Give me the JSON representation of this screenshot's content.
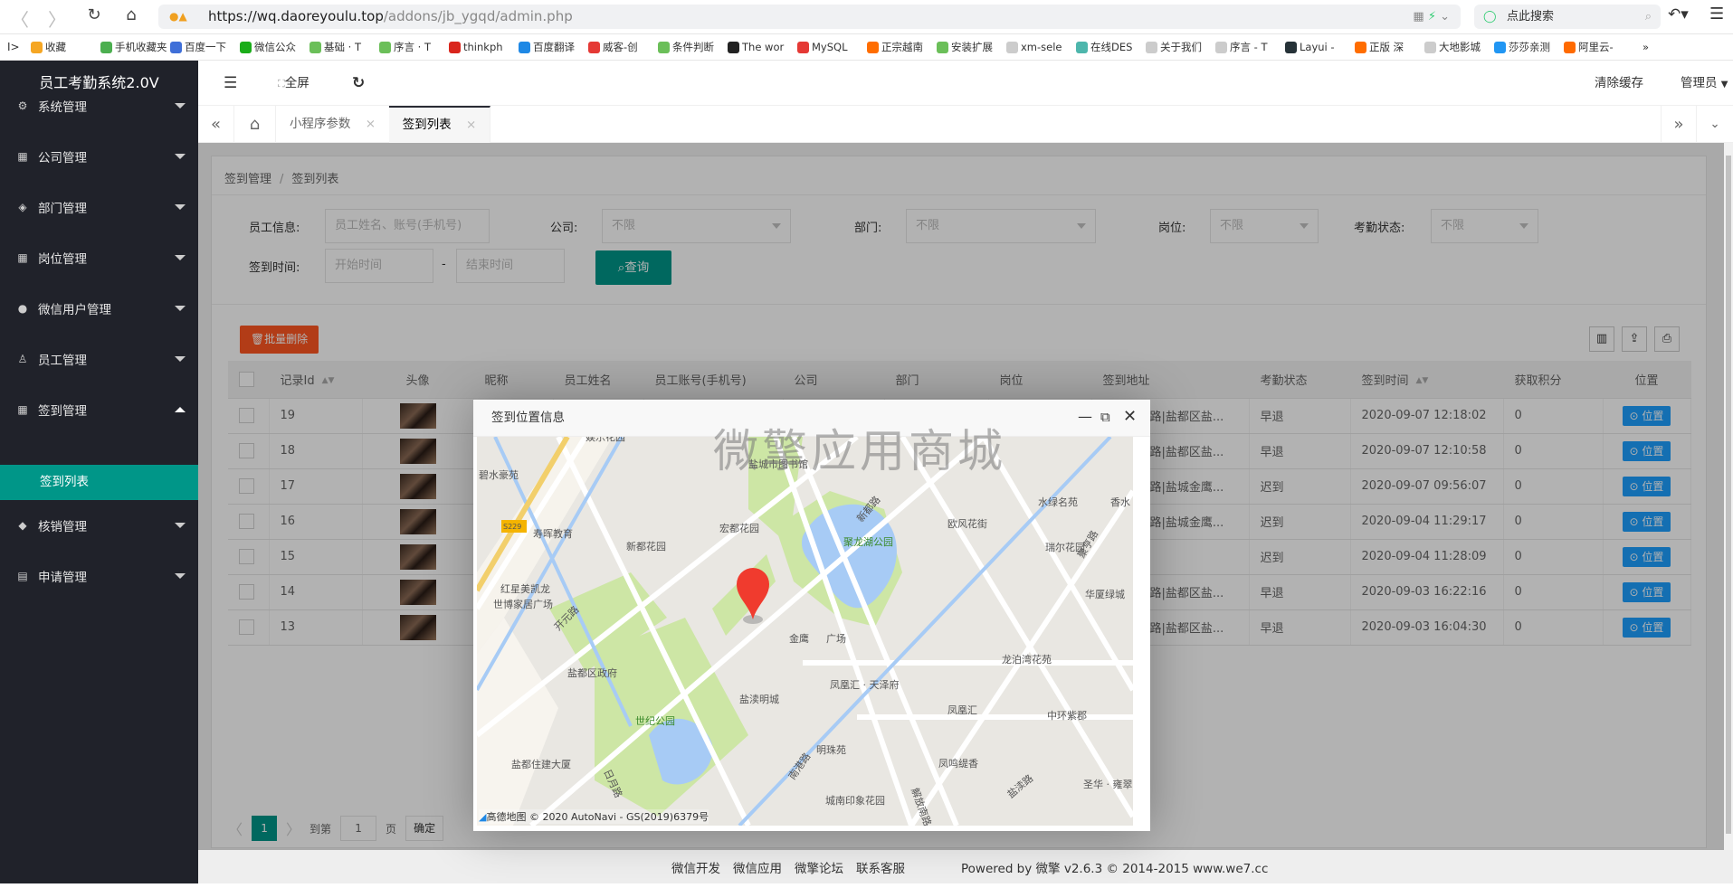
{
  "browser": {
    "url_host": "https://wq.daoreyoulu.top",
    "url_path": "/addons/jb_ygqd/admin.php",
    "search_placeholder": "点此搜索",
    "bookmarks": [
      "收藏",
      "手机收藏夹",
      "百度一下",
      "微信公众",
      "基础 · T",
      "序言 · T",
      "thinkph",
      "百度翻译",
      "威客-创",
      "条件判断",
      "The wor",
      "MySQL",
      "正宗越南",
      "安装扩展",
      "xm-sele",
      "在线DES",
      "关于我们",
      "序言 - T",
      "Layui -",
      "正版 深",
      "大地影城",
      "莎莎亲测",
      "阿里云-"
    ],
    "bookmark_colors": [
      "#f5a623",
      "#4caf50",
      "#3f6fd8",
      "#1aad19",
      "#6bbf59",
      "#6bbf59",
      "#d9251c",
      "#1e88e5",
      "#e53935",
      "#6bbf59",
      "#222222",
      "#e53935",
      "#ff6d00",
      "#6bbf59",
      "#cccccc",
      "#4db6ac",
      "#cccccc",
      "#cccccc",
      "#263238",
      "#ff6d00",
      "#cccccc",
      "#2196f3",
      "#ff6a00"
    ]
  },
  "app": {
    "title": "员工考勤系统2.0V"
  },
  "sidebar": {
    "items": [
      {
        "label": "系统管理",
        "icon": "⚙"
      },
      {
        "label": "公司管理",
        "icon": "▦"
      },
      {
        "label": "部门管理",
        "icon": "◈"
      },
      {
        "label": "岗位管理",
        "icon": "▦"
      },
      {
        "label": "微信用户管理",
        "icon": "●"
      },
      {
        "label": "员工管理",
        "icon": "♙"
      },
      {
        "label": "签到管理",
        "icon": "▦"
      },
      {
        "label": "核销管理",
        "icon": "◆"
      },
      {
        "label": "申请管理",
        "icon": "▤"
      }
    ],
    "active_sub": "签到列表",
    "active_color": "#009688"
  },
  "header": {
    "fullscreen": "全屏",
    "clear_cache": "清除缓存",
    "user": "管理员"
  },
  "tabs": [
    {
      "label": "小程序参数"
    },
    {
      "label": "签到列表",
      "active": true
    }
  ],
  "breadcrumb": [
    "签到管理",
    "签到列表"
  ],
  "filters": {
    "employee_label": "员工信息:",
    "employee_placeholder": "员工姓名、账号(手机号)",
    "company_label": "公司:",
    "company_value": "不限",
    "dept_label": "部门:",
    "dept_value": "不限",
    "post_label": "岗位:",
    "post_value": "不限",
    "status_label": "考勤状态:",
    "status_value": "不限",
    "time_label": "签到时间:",
    "start_placeholder": "开始时间",
    "end_placeholder": "结束时间",
    "dash": "-",
    "search_button": "查询"
  },
  "toolbar": {
    "batch_delete": "批量删除"
  },
  "table": {
    "columns": [
      "记录Id",
      "头像",
      "昵称",
      "员工姓名",
      "员工账号(手机号)",
      "公司",
      "部门",
      "岗位",
      "签到地址",
      "考勤状态",
      "签到时间",
      "获取积分",
      "位置"
    ],
    "rows": [
      {
        "id": "19",
        "address": "路|盐都区盐...",
        "status": "早退",
        "time": "2020-09-07 12:18:02",
        "points": "0",
        "action": "位置"
      },
      {
        "id": "18",
        "address": "路|盐都区盐...",
        "status": "早退",
        "time": "2020-09-07 12:10:58",
        "points": "0",
        "action": "位置"
      },
      {
        "id": "17",
        "address": "路|盐城金鹰...",
        "status": "迟到",
        "time": "2020-09-07 09:56:07",
        "points": "0",
        "action": "位置"
      },
      {
        "id": "16",
        "address": "路|盐城金鹰...",
        "status": "迟到",
        "time": "2020-09-04 11:29:17",
        "points": "0",
        "action": "位置"
      },
      {
        "id": "15",
        "address": "",
        "status": "迟到",
        "time": "2020-09-04 11:28:09",
        "points": "0",
        "action": "位置"
      },
      {
        "id": "14",
        "address": "路|盐都区盐...",
        "status": "早退",
        "time": "2020-09-03 16:22:16",
        "points": "0",
        "action": "位置"
      },
      {
        "id": "13",
        "address": "路|盐都区盐...",
        "status": "早退",
        "time": "2020-09-03 16:04:30",
        "points": "0",
        "action": "位置"
      }
    ]
  },
  "pager": {
    "current": "1",
    "goto_label": "到第",
    "goto_value": "1",
    "page_suffix": "页",
    "confirm": "确定"
  },
  "modal": {
    "title": "签到位置信息",
    "watermark": "微擎应用商城",
    "map_labels": [
      "娱乐花园",
      "盐城市图书馆",
      "碧水豪苑",
      "水绿名苑",
      "香水",
      "寿晖教育",
      "宏都花园",
      "新都花园",
      "聚龙湖公园",
      "欧风花街",
      "瑞尔花园",
      "新都路",
      "聚亨路",
      "红星美凯龙",
      "世博家居广场",
      "华厦绿城",
      "开元路",
      "金鹰",
      "广场",
      "盐都区政府",
      "龙泊湾花苑",
      "凤凰汇 · 天泽府",
      "盐渎明城",
      "凤凰汇",
      "世纪公园",
      "中环紫郡",
      "明珠苑",
      "凤鸣缇香",
      "盐都住建大厦",
      "日月路",
      "南港路",
      "圣华 · 雍翠",
      "城南印象花园",
      "盐渎路",
      "解放南路",
      "S229"
    ],
    "copyright": "高德地图 © 2020 AutoNavi - GS(2019)6379号"
  },
  "footer": {
    "links": [
      "微信开发",
      "微信应用",
      "微擎论坛",
      "联系客服"
    ],
    "powered": "Powered by 微擎 v2.6.3 © 2014-2015 www.we7.cc"
  }
}
